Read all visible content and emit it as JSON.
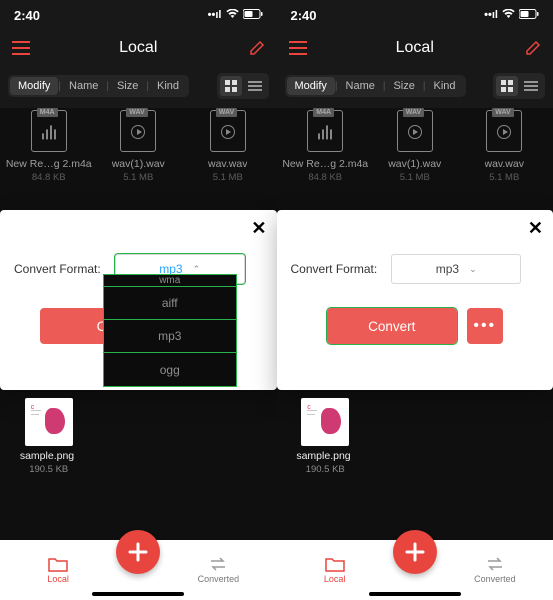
{
  "statusbar": {
    "time": "2:40"
  },
  "nav": {
    "title": "Local"
  },
  "sort": {
    "modify": "Modify",
    "name": "Name",
    "size": "Size",
    "kind": "Kind"
  },
  "files": [
    {
      "tag": "M4A",
      "name": "New Re…g 2.m4a",
      "size": "84.8 KB",
      "icon": "bars"
    },
    {
      "tag": "WAV",
      "name": "wav(1).wav",
      "size": "5.1 MB",
      "icon": "play"
    },
    {
      "tag": "WAV",
      "name": "wav.wav",
      "size": "5.1 MB",
      "icon": "play"
    }
  ],
  "thumb": {
    "name": "sample.png",
    "size": "190.5 KB"
  },
  "sheet": {
    "label": "Convert Format:",
    "selected": "mp3",
    "options": [
      "wma",
      "aiff",
      "mp3",
      "ogg"
    ],
    "convert": "Convert",
    "more": "•••"
  },
  "tabs": {
    "local": "Local",
    "converted": "Converted"
  }
}
